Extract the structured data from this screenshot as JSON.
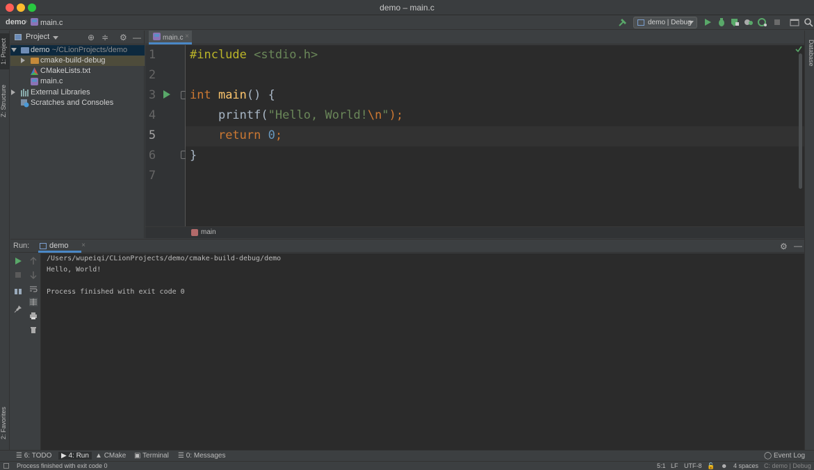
{
  "window": {
    "title": "demo – main.c"
  },
  "nav": {
    "project": "demo",
    "file": "main.c",
    "run_config": "demo | Debug"
  },
  "left_stripe": {
    "project_tab": "1: Project",
    "structure_tab": "Z: Structure",
    "favorites_tab": "2: Favorites"
  },
  "right_stripe": {
    "database_tab": "Database"
  },
  "project_panel": {
    "title": "Project",
    "tree": [
      {
        "name": "demo",
        "detail": "~/CLionProjects/demo"
      },
      {
        "name": "cmake-build-debug"
      },
      {
        "name": "CMakeLists.txt"
      },
      {
        "name": "main.c"
      },
      {
        "name": "External Libraries"
      },
      {
        "name": "Scratches and Consoles"
      }
    ]
  },
  "editor": {
    "tab": "main.c",
    "line_numbers": [
      "1",
      "2",
      "3",
      "4",
      "5",
      "6",
      "7"
    ],
    "current_line": 5,
    "breadcrumb": "main",
    "code": {
      "l1_directive": "#include",
      "l1_header": " <stdio.h>",
      "l3_type": "int",
      "l3_name": " main",
      "l3_rest": "() {",
      "l4_indent": "    ",
      "l4_call": "printf",
      "l4_open": "(",
      "l4_str_a": "\"Hello, World!",
      "l4_esc": "\\n",
      "l4_str_b": "\"",
      "l4_close": ");",
      "l5_indent": "    ",
      "l5_kw": "return",
      "l5_num": " 0",
      "l5_semi": ";",
      "l6": "}"
    }
  },
  "run_panel": {
    "label": "Run:",
    "tab": "demo",
    "console": [
      "/Users/wupeiqi/CLionProjects/demo/cmake-build-debug/demo",
      "Hello, World!",
      "",
      "Process finished with exit code 0"
    ]
  },
  "bottom_tools": {
    "todo": "6: TODO",
    "run": "4: Run",
    "cmake": "CMake",
    "terminal": "Terminal",
    "messages": "0: Messages",
    "event_log": "Event Log"
  },
  "status": {
    "message": "Process finished with exit code 0",
    "position": "5:1",
    "line_sep": "LF",
    "encoding": "UTF-8",
    "indent": "4 spaces",
    "context": "C: demo | Debug"
  }
}
